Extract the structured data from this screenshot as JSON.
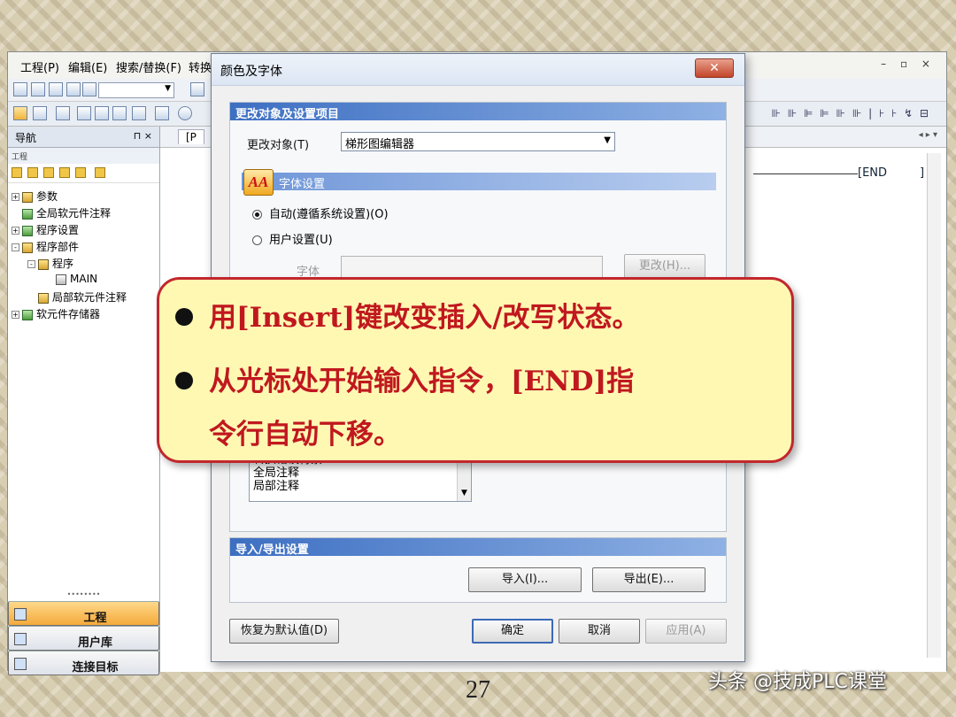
{
  "menu": [
    "工程(P)",
    "编辑(E)",
    "搜索/替换(F)",
    "转换"
  ],
  "navigation": {
    "title": "导航",
    "controls": "⊓ ×",
    "subtitle": "工程",
    "tree": [
      {
        "label": "参数",
        "level": 0,
        "expander": "+"
      },
      {
        "label": "全局软元件注释",
        "level": 0,
        "expander": ""
      },
      {
        "label": "程序设置",
        "level": 0,
        "expander": "+"
      },
      {
        "label": "程序部件",
        "level": 0,
        "expander": "-"
      },
      {
        "label": "程序",
        "level": 1,
        "expander": "-"
      },
      {
        "label": "MAIN",
        "level": 2,
        "expander": ""
      },
      {
        "label": "局部软元件注释",
        "level": 1,
        "expander": ""
      },
      {
        "label": "软元件存储器",
        "level": 0,
        "expander": "+"
      }
    ],
    "bottom_buttons": [
      "工程",
      "用户库",
      "连接目标"
    ]
  },
  "editor": {
    "tab_label": "[P",
    "end_label": "[END",
    "end_bracket": "]",
    "nav_arrows": "◂ ▸ ▾"
  },
  "dialog": {
    "title": "颜色及字体",
    "close": "✕",
    "section_change": "更改对象及设置项目",
    "target_label": "更改对象(T)",
    "target_value": "梯形图编辑器",
    "font_settings": "字体设置",
    "font_icon": "AA",
    "radio_auto": "自动(遵循系统设置)(O)",
    "radio_user": "用户设置(U)",
    "font_label": "字体",
    "change_button": "更改(H)...",
    "list_items": [
      "转换错误背景",
      "全局注释",
      "局部注释"
    ],
    "section_io": "导入/导出设置",
    "import_button": "导入(I)...",
    "export_button": "导出(E)...",
    "reset_button": "恢复为默认值(D)",
    "ok_button": "确定",
    "cancel_button": "取消",
    "apply_button": "应用(A)"
  },
  "callout": {
    "bullet1": "用[Insert]键改变插入/改写状态。",
    "bullet2_line1": "从光标处开始输入指令，[END]指",
    "bullet2_line2": "令行自动下移。"
  },
  "slide": {
    "page_number": "27",
    "watermark": "头条 @技成PLC课堂"
  },
  "colors": {
    "callout_bg": "#fff8b3",
    "callout_border": "#c2272d",
    "callout_text": "#c0181f",
    "section_header": "#3d6fc2"
  }
}
